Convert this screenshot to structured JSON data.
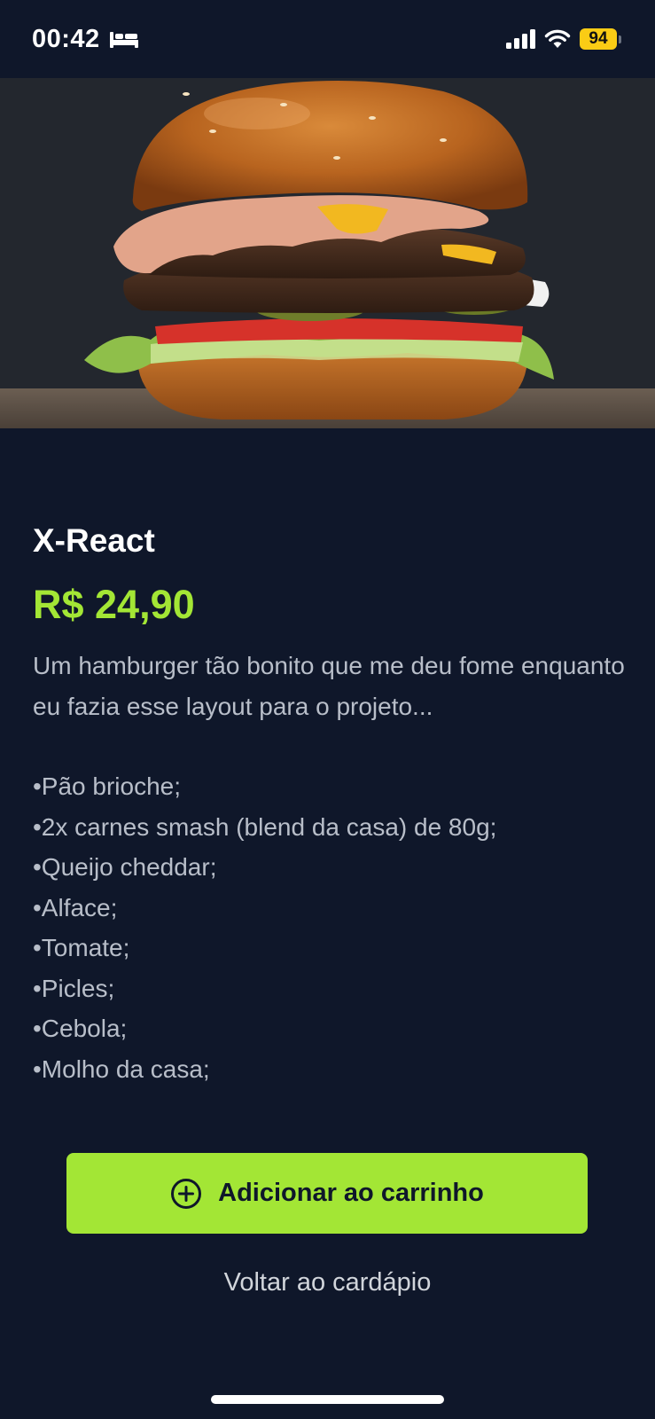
{
  "status_bar": {
    "time": "00:42",
    "battery": "94",
    "icons": [
      "bed-icon",
      "signal-icon",
      "wifi-icon",
      "battery-icon"
    ]
  },
  "product": {
    "image": "burger-photo",
    "name": "X-React",
    "price": "R$ 24,90",
    "description": "Um hamburger tão bonito que me deu fome enquanto eu fazia esse layout para o projeto...",
    "ingredients": [
      "•Pão brioche;",
      "•2x carnes smash (blend da casa) de 80g;",
      "•Queijo cheddar;",
      "•Alface;",
      "•Tomate;",
      "•Picles;",
      "•Cebola;",
      "•Molho da casa;"
    ]
  },
  "actions": {
    "add_to_cart_label": "Adicionar ao carrinho",
    "add_to_cart_icon": "plus-circle-icon",
    "back_label": "Voltar ao cardápio"
  },
  "colors": {
    "background": "#0f172a",
    "accent": "#a3e635",
    "text_muted": "#b8bec9",
    "battery": "#facc15"
  }
}
